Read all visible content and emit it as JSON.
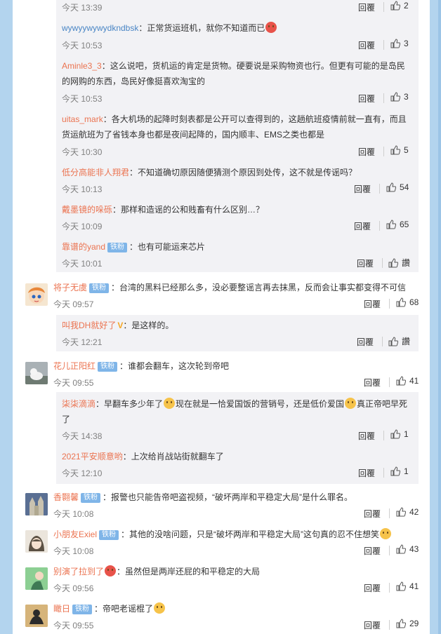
{
  "ui": {
    "reply_label": "回覆",
    "like_label": "讚",
    "badge_label": "铁粉",
    "name_separator": "："
  },
  "comments": [
    {
      "kind": "reply",
      "time": "今天 13:39",
      "likes": "2"
    },
    {
      "kind": "reply",
      "name": "wywyywywydkndbsk",
      "lines": [
        "：正常货运班机，就你不知道而已"
      ],
      "time": "今天 10:53",
      "likes": "3",
      "emoji_end": "red"
    },
    {
      "kind": "reply",
      "name": "Aminle3_3",
      "lines": [
        "：这么说吧，货机运的肯定是货物。硬要说是采购物资也行。但更有可能的是岛民",
        "的网购的东西，岛民好像挺喜欢淘宝的"
      ],
      "time": "今天 10:53",
      "likes": "3"
    },
    {
      "kind": "reply",
      "name": "uitas_mark",
      "lines": [
        "：各大机场的起降时刻表都是公开可以查得到的，这趟航班疫情前就一直有，而且",
        "货运航班为了省钱本身也都是夜间起降的，国内顺丰、EMS之类也都是"
      ],
      "time": "今天 10:30",
      "likes": "5"
    },
    {
      "kind": "reply",
      "name": "低分高能非人翔君",
      "lines": [
        "：不知道确切原因随便猜测个原因到处传，这不就是传谣吗？"
      ],
      "time": "今天 10:13",
      "likes": "54"
    },
    {
      "kind": "reply",
      "name": "戴墨镜的哚砾",
      "lines": [
        "：那样和造谣的公和贱畜有什么区别…？"
      ],
      "time": "今天 10:09",
      "likes": "65"
    },
    {
      "kind": "reply",
      "name": "靠谱的yand",
      "badge": true,
      "lines": [
        "：也有可能运来芯片"
      ],
      "time": "今天 10:01"
    },
    {
      "kind": "main",
      "name": "将子无虞",
      "badge": true,
      "lines": [
        "：台湾的黑料已经那么多，没必要整谣言再去抹黑，反而会让事实都变得不可信"
      ],
      "time": "今天 09:57",
      "likes": "68",
      "avatar": "anime"
    },
    {
      "kind": "reply",
      "name": "叫我DH就好了",
      "vip": true,
      "lines": [
        "：是这样的。"
      ],
      "time": "今天 12:21"
    },
    {
      "kind": "main",
      "name": "花儿正阳红",
      "badge": true,
      "lines": [
        "：谁都会翻车，这次轮到帝吧"
      ],
      "time": "今天 09:55",
      "likes": "41",
      "avatar": "cat"
    },
    {
      "kind": "reply",
      "name": "柒柒滴滴",
      "lines": [
        "：早翻车多少年了",
        "现在就是一恰爱国饭的营销号，还是低价爱国",
        "真正帝吧早死",
        "了"
      ],
      "time": "今天 14:38",
      "likes": "1"
    },
    {
      "kind": "reply",
      "name": "2021平安顺意哟",
      "lines": [
        "：上次给肖战站街就翻车了"
      ],
      "time": "今天 12:10",
      "likes": "1"
    },
    {
      "kind": "main",
      "name": "香翾馨",
      "badge": true,
      "lines": [
        "：报警也只能告帝吧盗视频，“破坏两岸和平稳定大局”是什么罪名。"
      ],
      "time": "今天 10:08",
      "likes": "42",
      "avatar": "church"
    },
    {
      "kind": "main",
      "name": "小朋友Exiel",
      "badge": true,
      "lines": [
        "：其他的没啥问题，只是“破坏两岸和平稳定大局”这句真的忍不住想笑"
      ],
      "time": "今天 10:08",
      "likes": "43",
      "avatar": "girl"
    },
    {
      "kind": "main",
      "name": "别演了拉到了",
      "lines": [
        "：虽然但是两岸还屁的和平稳定的大局"
      ],
      "time": "今天 09:56",
      "likes": "41",
      "avatar": "green"
    },
    {
      "kind": "main",
      "name": "瞰日",
      "badge": true,
      "lines": [
        "：帝吧老谣棍了"
      ],
      "time": "今天 09:55",
      "likes": "29",
      "avatar": "dark"
    }
  ]
}
